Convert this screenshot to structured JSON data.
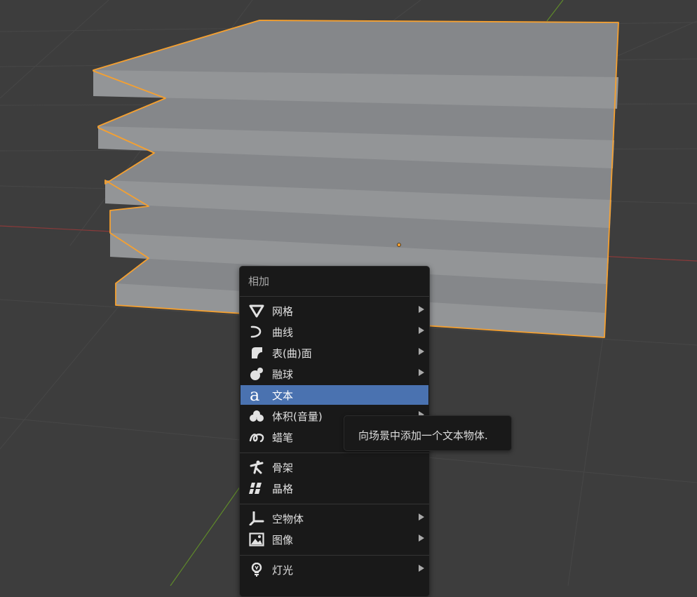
{
  "viewport": {
    "background": "#3d3d3d",
    "selection_outline": "#f5a030",
    "object_faces": [
      "#8a8c8e",
      "#7d7f81"
    ]
  },
  "menu": {
    "title": "相加",
    "items": [
      {
        "label": "网格",
        "icon": "mesh-cone-icon",
        "submenu": true
      },
      {
        "label": "曲线",
        "icon": "curve-icon",
        "submenu": true
      },
      {
        "label": "表(曲)面",
        "icon": "surface-icon",
        "submenu": true
      },
      {
        "label": "融球",
        "icon": "metaball-icon",
        "submenu": true
      },
      {
        "label": "文本",
        "icon": "text-icon",
        "submenu": false,
        "highlighted": true
      },
      {
        "label": "体积(音量)",
        "icon": "volume-icon",
        "submenu": true
      },
      {
        "label": "蜡笔",
        "icon": "grease-pencil-icon",
        "submenu": false
      },
      {
        "label": "骨架",
        "icon": "armature-icon",
        "submenu": false
      },
      {
        "label": "晶格",
        "icon": "lattice-icon",
        "submenu": false
      },
      {
        "label": "空物体",
        "icon": "empty-icon",
        "submenu": true
      },
      {
        "label": "图像",
        "icon": "image-icon",
        "submenu": true
      },
      {
        "label": "灯光",
        "icon": "light-icon",
        "submenu": true
      }
    ]
  },
  "tooltip": {
    "text": "向场景中添加一个文本物体."
  },
  "accent": "#4a72b0"
}
